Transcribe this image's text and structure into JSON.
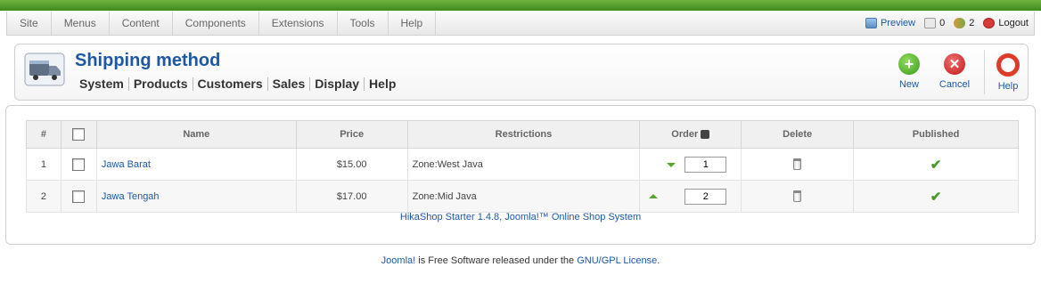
{
  "menu": [
    "Site",
    "Menus",
    "Content",
    "Components",
    "Extensions",
    "Tools",
    "Help"
  ],
  "status": {
    "preview": "Preview",
    "messages": "0",
    "users": "2",
    "logout": "Logout"
  },
  "header": {
    "title": "Shipping method",
    "subnav": [
      "System",
      "Products",
      "Customers",
      "Sales",
      "Display",
      "Help"
    ]
  },
  "toolbar": {
    "new_label": "New",
    "cancel_label": "Cancel",
    "help_label": "Help"
  },
  "table": {
    "columns": [
      "#",
      "",
      "Name",
      "Price",
      "Restrictions",
      "Order",
      "Delete",
      "Published"
    ],
    "rows": [
      {
        "num": "1",
        "name": "Jawa Barat",
        "price": "$15.00",
        "restriction": "Zone:West Java",
        "order": "1",
        "published": true
      },
      {
        "num": "2",
        "name": "Jawa Tengah",
        "price": "$17.00",
        "restriction": "Zone:Mid Java",
        "order": "2",
        "published": true
      }
    ]
  },
  "footer": {
    "hika": "HikaShop Starter 1.4.8, Joomla!™ Online Shop System",
    "joomla_link": "Joomla!",
    "joomla_text": " is Free Software released under the ",
    "license_link": "GNU/GPL License",
    "period": "."
  },
  "colors": {
    "accent": "#1d58a7",
    "topbar": "#4f9e2a",
    "new": "#58b531",
    "cancel": "#d62b2b",
    "help": "#e03a2a"
  }
}
